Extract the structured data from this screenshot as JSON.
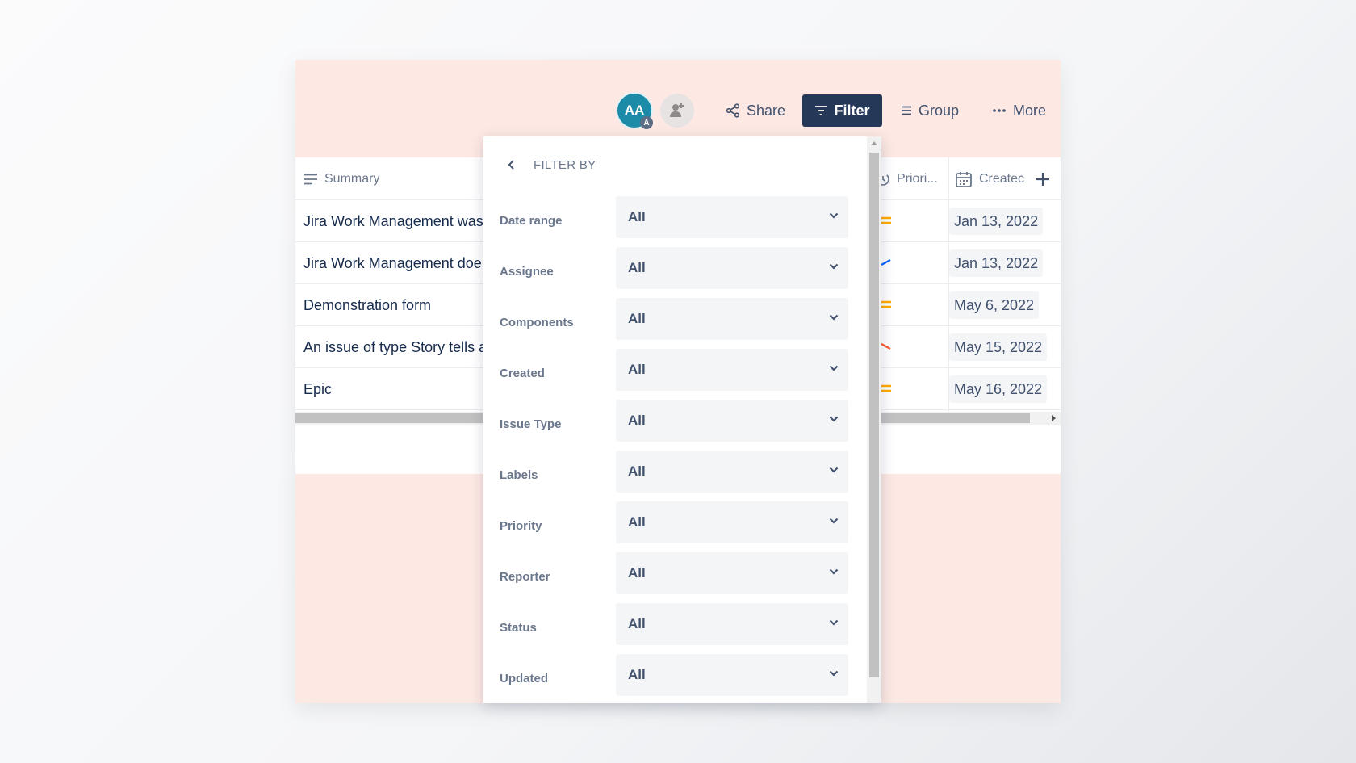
{
  "toolbar": {
    "avatar_initials": "AA",
    "avatar_badge": "A",
    "share_label": "Share",
    "filter_label": "Filter",
    "group_label": "Group",
    "more_label": "More"
  },
  "table": {
    "columns": {
      "summary": "Summary",
      "priority": "Priori...",
      "created": "Createc"
    },
    "rows": [
      {
        "summary": "Jira Work Management was",
        "priority_icon": "medium-priority-icon",
        "created": "Jan 13, 2022"
      },
      {
        "summary": "Jira Work Management doe",
        "priority_icon": "low-priority-icon",
        "created": "Jan 13, 2022"
      },
      {
        "summary": "Demonstration form",
        "priority_icon": "medium-priority-icon",
        "created": "May 6, 2022"
      },
      {
        "summary": "An issue of type Story tells a",
        "priority_icon": "high-priority-icon",
        "created": "May 15, 2022"
      },
      {
        "summary": "Epic",
        "priority_icon": "medium-priority-icon",
        "created": "May 16, 2022"
      }
    ]
  },
  "filter_panel": {
    "title": "FILTER BY",
    "filters": [
      {
        "label": "Date range",
        "value": "All"
      },
      {
        "label": "Assignee",
        "value": "All"
      },
      {
        "label": "Components",
        "value": "All"
      },
      {
        "label": "Created",
        "value": "All"
      },
      {
        "label": "Issue Type",
        "value": "All"
      },
      {
        "label": "Labels",
        "value": "All"
      },
      {
        "label": "Priority",
        "value": "All"
      },
      {
        "label": "Reporter",
        "value": "All"
      },
      {
        "label": "Status",
        "value": "All"
      },
      {
        "label": "Updated",
        "value": "All"
      }
    ]
  },
  "colors": {
    "card_background": "#fde8e3",
    "filter_button": "#253858",
    "avatar": "#1c8ba8",
    "priority_medium": "#ffab00",
    "priority_low": "#0065ff",
    "priority_high": "#ff5630"
  }
}
